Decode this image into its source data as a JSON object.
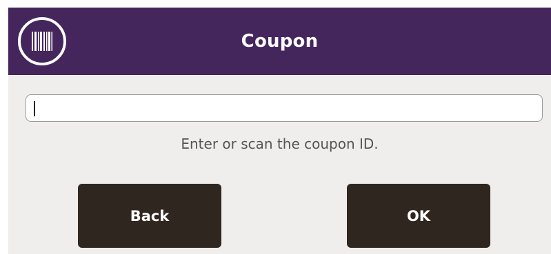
{
  "header": {
    "title": "Coupon",
    "barcode_icon": "barcode-scan-icon",
    "background_color": "#45265c"
  },
  "input": {
    "value": "",
    "placeholder": ""
  },
  "prompt": "Enter or scan the coupon ID.",
  "buttons": {
    "back_label": "Back",
    "ok_label": "OK",
    "background_color": "#302620"
  }
}
